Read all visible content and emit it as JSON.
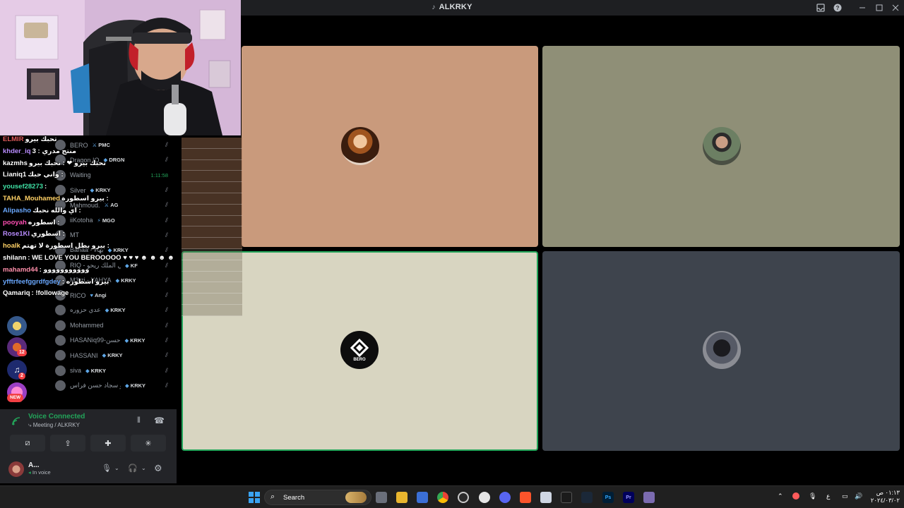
{
  "window": {
    "title": "ALKRKY"
  },
  "colors": {
    "discord_bg": "#000000",
    "titlebar_bg": "#1e1f22",
    "speaking_border": "#23a55a",
    "voice_connected": "#23a55a",
    "taskbar_bg": "#202020"
  },
  "call": {
    "tiles": [
      {
        "name": "participant-1",
        "bg": "#c99a7c",
        "speaking": false
      },
      {
        "name": "participant-2",
        "bg": "#8f8f77",
        "speaking": false
      },
      {
        "name": "participant-3",
        "bg": "#d8d5c1",
        "speaking": true,
        "label": "BERO"
      },
      {
        "name": "participant-4",
        "bg": "#3e444d",
        "speaking": false
      }
    ]
  },
  "chat": {
    "lines": [
      {
        "user": "ELMIR",
        "text": "تحبك بيرو",
        "color": "#e05b5b"
      },
      {
        "user": "khder_iq",
        "text": "3 : منتج مدري",
        "color": "#b98cff"
      },
      {
        "user": "kazmhs",
        "text": "تحبك بيرو ❤ : نحبك بيرو",
        "color": "#ffffff"
      },
      {
        "user": "Lianiq1",
        "text": "واني حبك :",
        "color": "#ffffff"
      },
      {
        "user": "yousef28273",
        "text": ":",
        "color": "#3fe1a5"
      },
      {
        "user": "TAHA_Mouhamed",
        "text": "بيرو اسطورة :",
        "color": "#ffd166"
      },
      {
        "user": "Alipasho",
        "text": "اي والله نحبك :",
        "color": "#6aa8ff"
      },
      {
        "user": "pooyah",
        "text": "اسطوره :",
        "color": "#ff4fb3"
      },
      {
        "user": "Rose1KI",
        "text": "اسطوري :",
        "color": "#b98cff"
      },
      {
        "user": "hoalk",
        "text": "بيرو بطل اسطورة لا تهتم :",
        "color": "#ffd166"
      },
      {
        "user": "shilann",
        "text": ": WE LOVE YOU BEROOOOO ♥ ♥ ♥ ☻ ☻ ☻ ☻ ♥ ♥ ♥ ♥",
        "color": "#ffffff"
      },
      {
        "user": "mahamd44",
        "text": ": ووووووووووو",
        "color": "#ff8fab"
      },
      {
        "user": "yfftrfeefggrdfgdey",
        "text": ": بيرو اسطوره",
        "color": "#6aa8ff"
      },
      {
        "user": "Qamariq",
        "text": ": !followage",
        "color": "#ffffff"
      }
    ]
  },
  "members": [
    {
      "name": "BERO",
      "tag": "PMC",
      "gem": "⚔"
    },
    {
      "name": "Dragon IQ",
      "tag": "DRGN",
      "gem": "◆"
    },
    {
      "name": "Waiting",
      "tag": "",
      "gem": "",
      "time": "1:11:58"
    },
    {
      "name": "Silver",
      "tag": "KRKY",
      "gem": "◆"
    },
    {
      "name": "Mahmoud.",
      "tag": "AG",
      "gem": "⚔"
    },
    {
      "name": "iiKotoha",
      "tag": "MGO",
      "gem": "⚡"
    },
    {
      "name": "MT",
      "tag": "",
      "gem": ""
    },
    {
      "name": "Bahaa - بهاء",
      "tag": "KRKY",
      "gem": "◆"
    },
    {
      "name": "RIQ - مسعتي الملك ريحو",
      "tag": "KF",
      "gem": "◆"
    },
    {
      "name": "M3tzi - YAHYA",
      "tag": "KRKY",
      "gem": "◆"
    },
    {
      "name": "RICO",
      "tag": "Angi",
      "gem": "♥"
    },
    {
      "name": "عدي حزوره",
      "tag": "KRKY",
      "gem": "◆"
    },
    {
      "name": "Mohammed",
      "tag": "",
      "gem": ""
    },
    {
      "name": "HASANiq99-حسن",
      "tag": "KRKY",
      "gem": "◆"
    },
    {
      "name": "HASSANI",
      "tag": "KRKY",
      "gem": "◆"
    },
    {
      "name": "siva",
      "tag": "KRKY",
      "gem": "◆"
    },
    {
      "name": "أبو سجاد حسن فراس",
      "tag": "KRKY",
      "gem": "◆"
    }
  ],
  "servers": [
    {
      "name": "server-1",
      "badge": ""
    },
    {
      "name": "server-2",
      "badge": "12"
    },
    {
      "name": "server-3",
      "badge": "2"
    },
    {
      "name": "server-4",
      "badge": "NEW"
    }
  ],
  "voice": {
    "status": "Voice Connected",
    "channel": "Meeting / ALKRKY"
  },
  "user": {
    "name": "A...",
    "status": "In voice"
  },
  "taskbar": {
    "search_label": "Search",
    "clock_time": "٠١:١٣ ص",
    "clock_date": "٢٠٢٤/٠٣/٠٢",
    "language": "ع"
  },
  "icons": {
    "win_pin": "inbox-icon",
    "win_help": "help-icon",
    "win_min": "minimize-icon",
    "win_max": "maximize-icon",
    "win_close": "close-icon"
  }
}
